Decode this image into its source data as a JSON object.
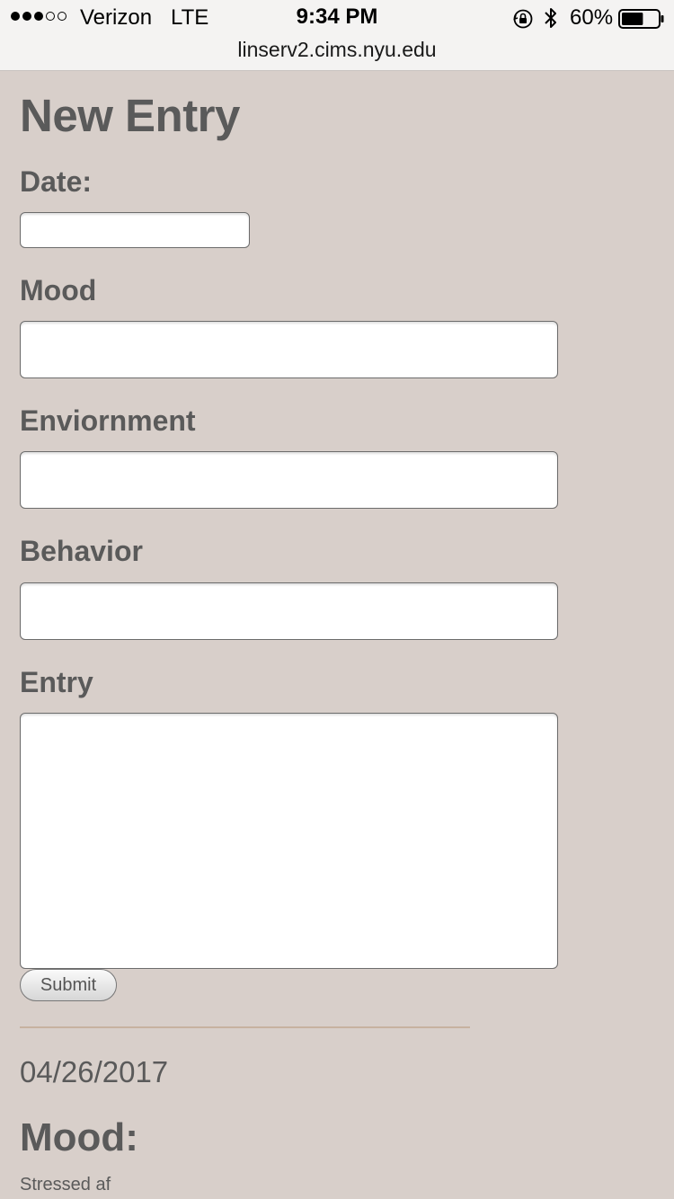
{
  "status_bar": {
    "signal_dots": [
      "full",
      "full",
      "full",
      "empty",
      "empty"
    ],
    "carrier": "Verizon",
    "network": "LTE",
    "time": "9:34 PM",
    "battery_percent": "60%",
    "battery_level": 0.6,
    "icons": [
      "rotation-lock-icon",
      "bluetooth-icon",
      "battery-icon"
    ]
  },
  "browser": {
    "url": "linserv2.cims.nyu.edu"
  },
  "form": {
    "title": "New Entry",
    "date_label": "Date:",
    "date_value": "",
    "mood_label": "Mood",
    "mood_value": "",
    "environment_label": "Enviornment",
    "environment_value": "",
    "behavior_label": "Behavior",
    "behavior_value": "",
    "entry_label": "Entry",
    "entry_value": "",
    "submit_label": "Submit"
  },
  "entries": [
    {
      "date": "04/26/2017",
      "mood_heading": "Mood:",
      "mood": "Stressed af"
    }
  ],
  "colors": {
    "page_background": "#d8cfca",
    "text": "#5a5a5a",
    "divider": "#c7b2a0",
    "topbar_background": "#f4f3f2"
  }
}
